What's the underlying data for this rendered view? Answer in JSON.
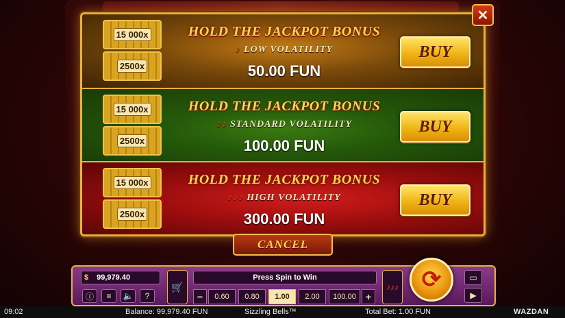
{
  "close_symbol": "✕",
  "offers": [
    {
      "title": "HOLD THE JACKPOT BONUS",
      "chilies": "♪",
      "volatility": "LOW VOLATILITY",
      "price": "50.00 FUN",
      "thumb_top": "15 000x",
      "thumb_bottom": "2500x",
      "buy_label": "BUY"
    },
    {
      "title": "HOLD THE JACKPOT BONUS",
      "chilies": "♪♪",
      "volatility": "STANDARD VOLATILITY",
      "price": "100.00 FUN",
      "thumb_top": "15 000x",
      "thumb_bottom": "2500x",
      "buy_label": "BUY"
    },
    {
      "title": "HOLD THE JACKPOT BONUS",
      "chilies": "♪♪♪",
      "volatility": "HIGH VOLATILITY",
      "price": "300.00 FUN",
      "thumb_top": "15 000x",
      "thumb_bottom": "2500x",
      "buy_label": "BUY"
    }
  ],
  "cancel_label": "CANCEL",
  "controls": {
    "balance_box": "99,979.40",
    "message": "Press Spin to Win",
    "bets": [
      "0.60",
      "0.80",
      "1.00",
      "2.00",
      "100.00"
    ],
    "selected_bet": "1.00",
    "minus": "−",
    "plus": "+",
    "info": "ⓘ",
    "menu": "≡",
    "sound": "🔈",
    "help": "?"
  },
  "footer": {
    "time": "09:02",
    "balance": "Balance: 99,979.40 FUN",
    "game": "Sizzling Bells™",
    "total_bet": "Total Bet: 1.00 FUN",
    "brand": "WAZDAN"
  },
  "colors": {
    "gold": "#e8b13a",
    "low_bg": "#c47a14",
    "standard_bg": "#3b7a12",
    "high_bg": "#d21c1c",
    "buy_button": "#f1b414"
  }
}
